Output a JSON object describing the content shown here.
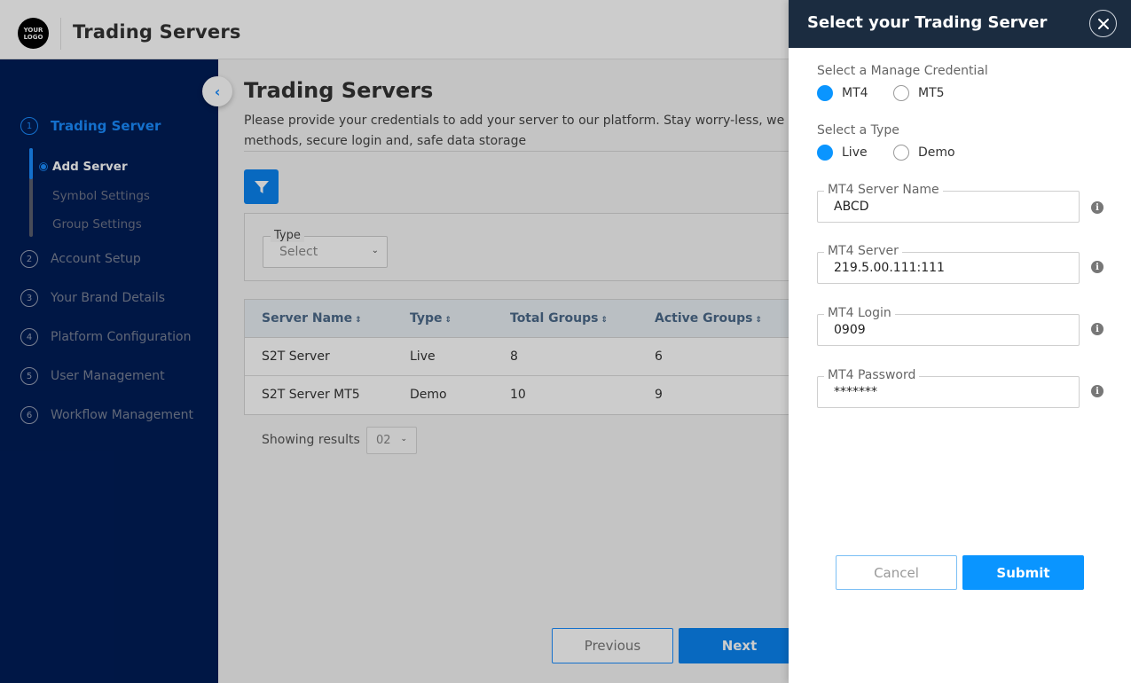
{
  "header": {
    "logo_line1": "YOUR",
    "logo_line2": "LOGO",
    "app_title": "Trading Servers"
  },
  "sidebar": {
    "steps": [
      {
        "num": "1",
        "label": "Trading Server",
        "active": true
      },
      {
        "num": "2",
        "label": "Account Setup"
      },
      {
        "num": "3",
        "label": "Your Brand Details"
      },
      {
        "num": "4",
        "label": "Platform Configuration"
      },
      {
        "num": "5",
        "label": "User Management"
      },
      {
        "num": "6",
        "label": "Workflow Management"
      }
    ],
    "substeps": [
      {
        "label": "Add Server",
        "active": true
      },
      {
        "label": "Symbol Settings"
      },
      {
        "label": "Group Settings"
      }
    ],
    "collapse_icon": "‹"
  },
  "main": {
    "title": "Trading Servers",
    "description": "Please provide your credentials to add your server to our platform. Stay worry-less, we methods, secure login and, safe data storage",
    "description_line1": "Please provide your credentials to add your server to our platform. Stay worry-less, we",
    "description_line2": "methods, secure login and, safe data storage",
    "filter": {
      "type_label": "Type",
      "type_value": "Select"
    },
    "table": {
      "columns": [
        "Server Name",
        "Type",
        "Total Groups",
        "Active Groups"
      ],
      "rows": [
        [
          "S2T Server",
          "Live",
          "8",
          "6"
        ],
        [
          "S2T Server MT5",
          "Demo",
          "10",
          "9"
        ]
      ]
    },
    "pagination": {
      "showing_label": "Showing results",
      "page_size": "02"
    },
    "previous_label": "Previous",
    "next_label": "Next"
  },
  "drawer": {
    "title": "Select your Trading Server",
    "credential_label": "Select a Manage Credential",
    "credential_options": [
      "MT4",
      "MT5"
    ],
    "credential_selected": "MT4",
    "type_label": "Select a Type",
    "type_options": [
      "Live",
      "Demo"
    ],
    "type_selected": "Live",
    "fields": [
      {
        "label": "MT4 Server Name",
        "value": "ABCD"
      },
      {
        "label": "MT4 Server",
        "value": "219.5.00.111:111"
      },
      {
        "label": "MT4 Login",
        "value": "0909"
      },
      {
        "label": "MT4 Password",
        "value": "*******"
      }
    ],
    "cancel_label": "Cancel",
    "submit_label": "Submit"
  },
  "colors": {
    "sidebar_bg": "#001d57",
    "accent": "#0a84f0",
    "drawer_header_bg": "#1b2c40",
    "submit_bg": "#0a95ff"
  }
}
